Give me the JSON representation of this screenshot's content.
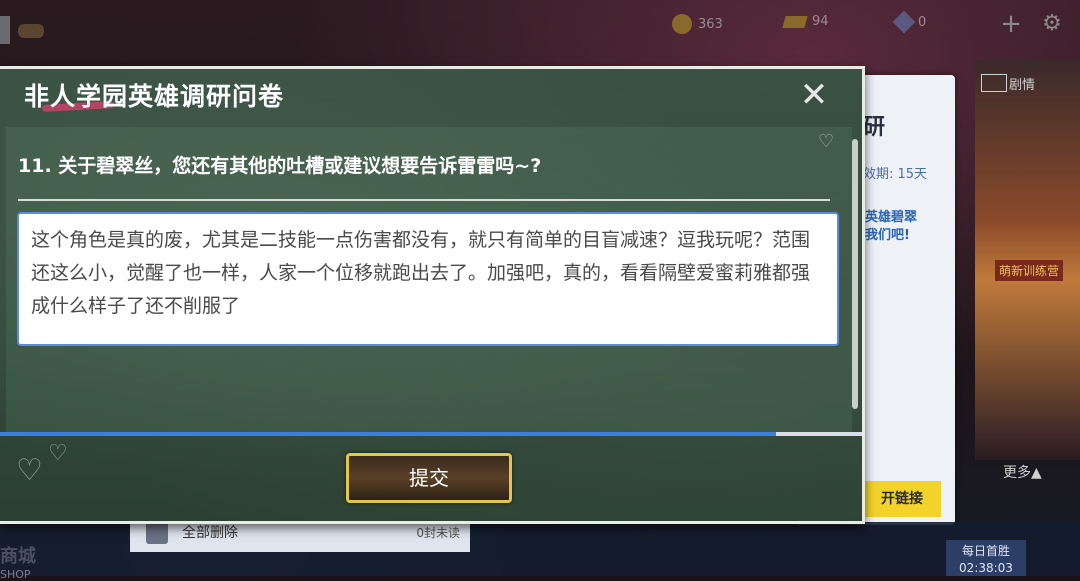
{
  "background": {
    "currency": {
      "coins": "363",
      "bars": "94",
      "gems": "0"
    },
    "right_card": {
      "title": "研",
      "validity": "效期:  15天",
      "desc_line1": "英雄碧翠",
      "desc_line2": "我们吧!",
      "link_button": "开链接"
    },
    "side_strip": {
      "plot_label": "剧情",
      "camp_label": "萌新训练营"
    },
    "more_label": "更多▲",
    "daily": {
      "label": "每日首胜",
      "timer": "02:38:03"
    },
    "bottom_nav": {
      "shop_label": "SHOP",
      "shop_cn": "商城"
    },
    "mail_bar": {
      "delete_all": "全部删除",
      "unread": "0封未读"
    }
  },
  "dialog": {
    "title": "非人学园英雄调研问卷",
    "close_icon": "close-icon",
    "question": "11. 关于碧翠丝，您还有其他的吐槽或建议想要告诉雷雷吗~?",
    "answer": "这个角色是真的废，尤其是二技能一点伤害都没有，就只有简单的目盲减速？逗我玩呢？范围还这么小，觉醒了也一样，人家一个位移就跑出去了。加强吧，真的，看看隔壁爱蜜莉雅都强成什么样子了还不削服了",
    "progress": 0.9,
    "submit_label": "提交"
  },
  "colors": {
    "chalkboard": "#2c4034",
    "answer_border": "#5b8ed6",
    "progress_fill": "#3c7fe0",
    "submit_border": "#e0c64a",
    "link_button": "#f3d22a"
  }
}
